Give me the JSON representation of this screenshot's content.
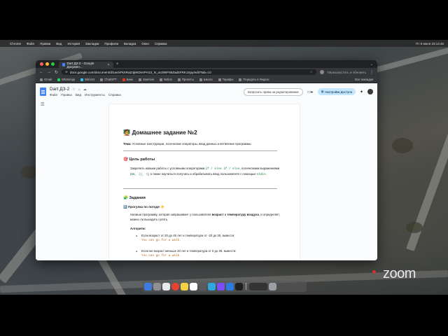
{
  "menubar": {
    "items": [
      "Chrome",
      "Файл",
      "Правка",
      "Вид",
      "История",
      "Закладки",
      "Профили",
      "Вкладка",
      "Окно",
      "Справка"
    ],
    "status": "Пт 6 июня 23:14:45"
  },
  "browser": {
    "tab_title": "Dart ДЗ-2 - Google Докумен...",
    "url": "docs.google.com/document/d/1wckFkXRaZ4j6KDvsPH13_N_ov2WiF66Zad4FRK1Spy/edit?tab=t.0",
    "right_text": "Перезапустить и обновить",
    "bookmarks": [
      "Gmail",
      "WhatsApp",
      "Bitrix24",
      "ChatGPT",
      "Банк",
      "Занятия",
      "Notion",
      "Проекты",
      "Школа",
      "Тарифы",
      "Передать в Яндекс"
    ],
    "bookmarks_right": "Все закладки"
  },
  "docs": {
    "title": "Dart ДЗ-2",
    "menus": [
      "Файл",
      "Правка",
      "Вид",
      "Инструменты",
      "Справка"
    ],
    "request_edit": "Запросить права на редактирование",
    "share": "Настройки Доступа"
  },
  "doc": {
    "h1": "🧑‍🏫 Домашнее задание №2",
    "topic_label": "Тема:",
    "topic_text": " Условные конструкции, логические операторы, ввод данных и ветвление программы",
    "goal_heading": "🎯 Цель работы",
    "goal_text_1": "Закрепить навыки работы с условными операторами ",
    "goal_code_1": "if / else if / else",
    "goal_text_2": ", логическими выражениями (",
    "goal_code_2": "&&, ||, !",
    "goal_text_3": "), а также научиться получать и обрабатывать ввод пользователя с помощью ",
    "goal_code_3": "stdin",
    "goal_text_4": ".",
    "tasks_heading": "🧩 Задания",
    "task1_title": "1️⃣ Прогулка по погоде ☀️",
    "task1_text_1": "Напиши программу, которая запрашивает у пользователя ",
    "task1_bold_1": "возраст",
    "task1_text_2": " и ",
    "task1_bold_2": "температуру воздуха",
    "task1_text_3": ", и определяет, можно ли выходить гулять.",
    "algo_label": "Алгоритм:",
    "bullet1_text": "Если возраст от 20 до 45 лет и температура от -20 до 30, вывести:",
    "bullet1_code": "You can go for a walk.",
    "bullet2_text": "Если же возраст меньше 20 лет и температура от 0 до 28, вывести:",
    "bullet2_code": "You can go for a walk."
  },
  "zoom": {
    "logo": "zoom"
  }
}
